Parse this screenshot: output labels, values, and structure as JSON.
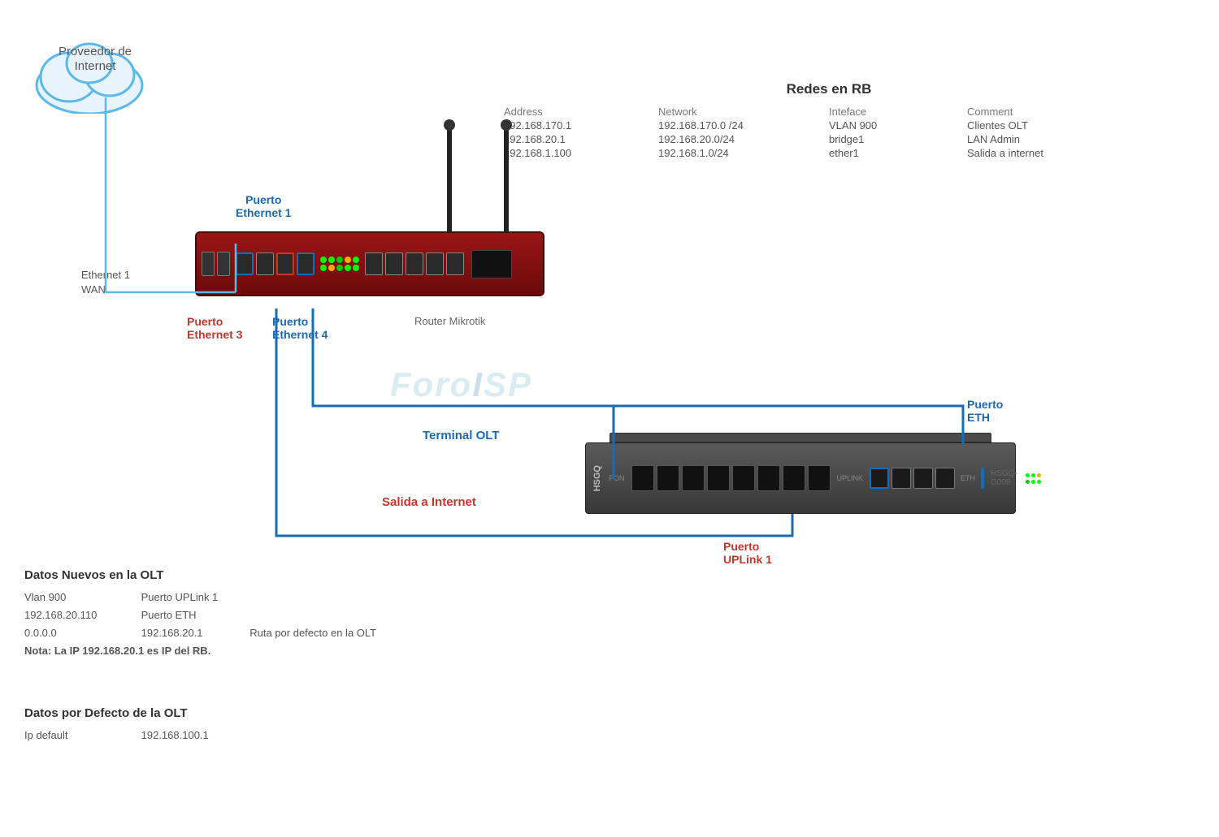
{
  "cloud": {
    "label_line1": "Proveedor de",
    "label_line2": "Internet"
  },
  "table": {
    "title": "Redes en RB",
    "headers": [
      "Address",
      "Network",
      "Inteface",
      "Comment"
    ],
    "rows": [
      [
        "192.168.170.1",
        "192.168.170.0 /24",
        "VLAN 900",
        "Clientes OLT"
      ],
      [
        "192.168.20.1",
        "192.168.20.0/24",
        "bridge1",
        "LAN Admin"
      ],
      [
        "192.168.1.100",
        "192.168.1.0/24",
        "ether1",
        "Salida a internet"
      ]
    ]
  },
  "labels": {
    "ethernet1_wan": "Ethernet 1\nWAN",
    "puerto_eth1": "Puerto\nEthernet 1",
    "puerto_eth3": "Puerto\nEthernet 3",
    "puerto_eth4": "Puerto\nEthernet 4",
    "router_mikrotik": "Router Mikrotik",
    "terminal_olt": "Terminal OLT",
    "salida_internet": "Salida a Internet",
    "puerto_eth": "Puerto\nETH",
    "puerto_uplink1": "Puerto\nUPLink 1",
    "foro_watermark": "ForoISP"
  },
  "info_nuevos": {
    "title": "Datos Nuevos en  la OLT",
    "rows": [
      {
        "col1": "Vlan 900",
        "col2": "Puerto UPLink 1"
      },
      {
        "col1": "192.168.20.110",
        "col2": "Puerto ETH"
      },
      {
        "col1": "0.0.0.0",
        "col2": "192.168.20.1",
        "col3": "Ruta  por defecto en la OLT"
      },
      {
        "col1": "Nota: La IP 192.168.20.1 es IP del RB."
      }
    ]
  },
  "info_defecto": {
    "title": "Datos por Defecto de la OLT",
    "rows": [
      {
        "col1": "Ip default",
        "col2": "192.168.100.1"
      }
    ]
  },
  "colors": {
    "blue": "#1a6bb5",
    "red": "#c0392b",
    "gray": "#777",
    "dark": "#333"
  }
}
